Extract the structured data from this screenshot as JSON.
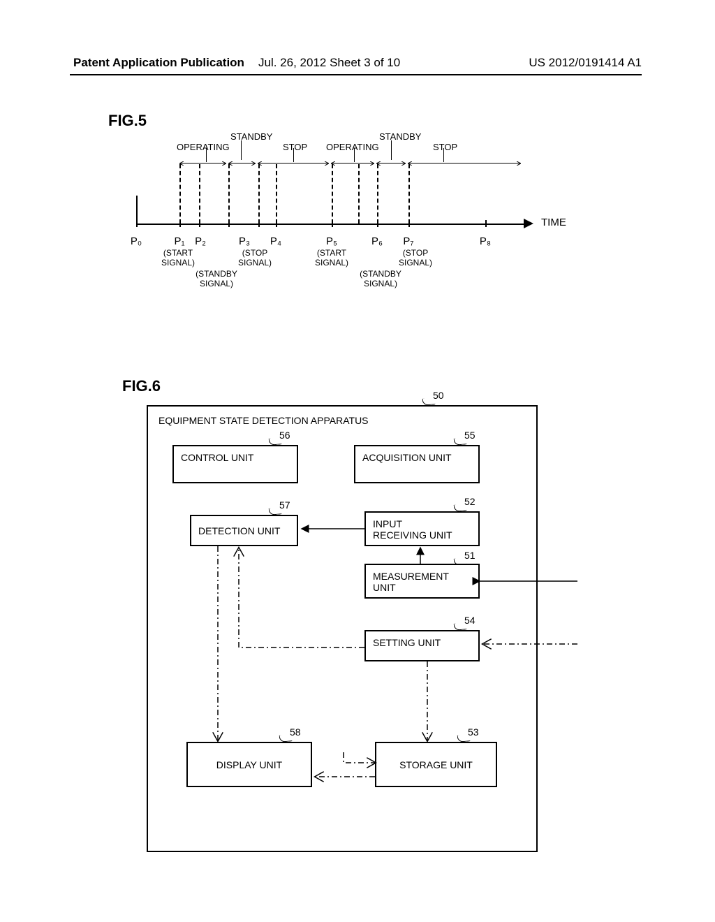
{
  "header": {
    "left": "Patent Application Publication",
    "center": "Jul. 26, 2012  Sheet 3 of 10",
    "right": "US 2012/0191414 A1"
  },
  "fig5": {
    "label": "FIG.5",
    "states": {
      "operating1": "OPERATING",
      "standby1": "STANDBY",
      "stop1": "STOP",
      "operating2": "OPERATING",
      "standby2": "STANDBY",
      "stop2": "STOP"
    },
    "timeLabel": "TIME",
    "points": {
      "p0": "P₀",
      "p1": "P₁",
      "p2": "P₂",
      "p3": "P₃",
      "p4": "P₄",
      "p5": "P₅",
      "p6": "P₆",
      "p7": "P₇",
      "p8": "P₈"
    },
    "sublabels": {
      "start1": "(START\nSIGNAL)",
      "standby1": "(STANDBY\nSIGNAL)",
      "stop1": "(STOP\nSIGNAL)",
      "start2": "(START\nSIGNAL)",
      "standby2": "(STANDBY\nSIGNAL)",
      "stop2": "(STOP\nSIGNAL)"
    }
  },
  "fig6": {
    "label": "FIG.6",
    "title": "EQUIPMENT STATE DETECTION APPARATUS",
    "refs": {
      "r50": "50",
      "r51": "51",
      "r52": "52",
      "r53": "53",
      "r54": "54",
      "r55": "55",
      "r56": "56",
      "r57": "57",
      "r58": "58"
    },
    "blocks": {
      "controlUnit": "CONTROL UNIT",
      "acquisitionUnit": "ACQUISITION UNIT",
      "detectionUnit": "DETECTION UNIT",
      "inputReceivingUnit": "INPUT\nRECEIVING UNIT",
      "measurementUnit": "MEASUREMENT\nUNIT",
      "settingUnit": "SETTING UNIT",
      "displayUnit": "DISPLAY UNIT",
      "storageUnit": "STORAGE UNIT"
    }
  }
}
